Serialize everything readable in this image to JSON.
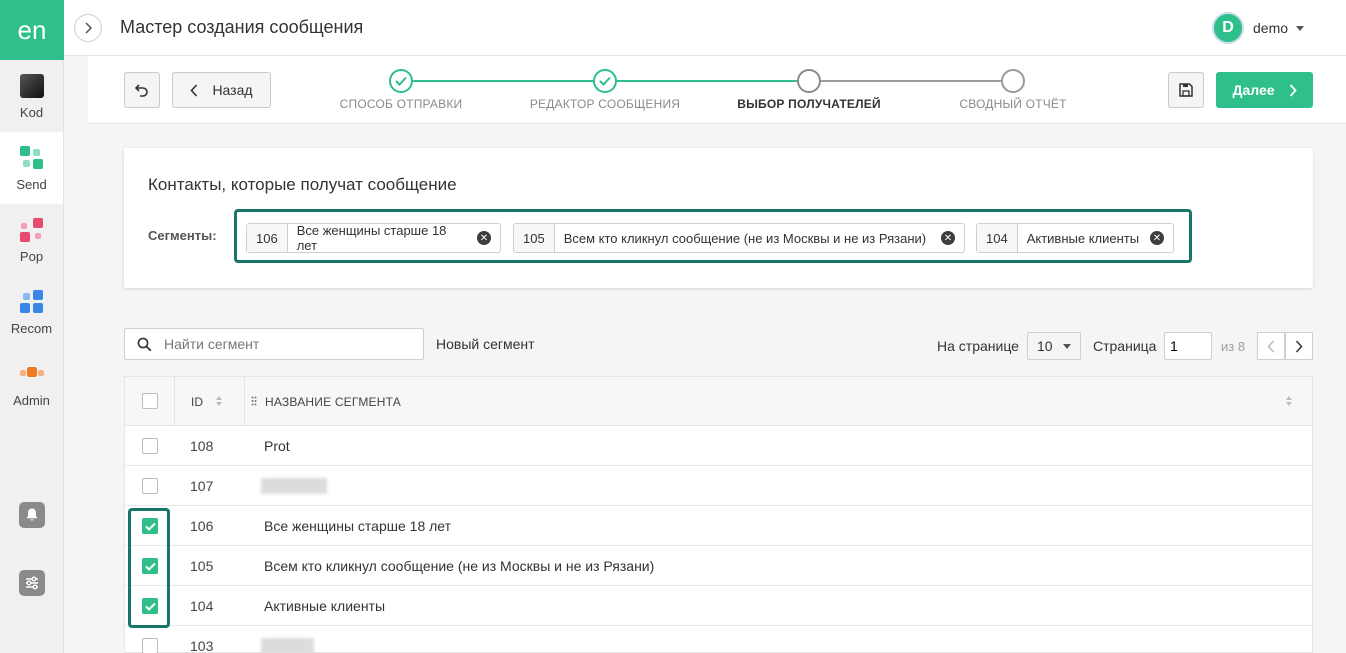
{
  "app": {
    "logo": "en",
    "title": "Мастер создания сообщения"
  },
  "rail": {
    "items": [
      {
        "label": "Kod",
        "icon": "kod-icon"
      },
      {
        "label": "Send",
        "icon": "send-icon",
        "active": true
      },
      {
        "label": "Pop",
        "icon": "pop-icon"
      },
      {
        "label": "Recom",
        "icon": "recom-icon"
      },
      {
        "label": "Admin",
        "icon": "admin-icon"
      }
    ],
    "bottom": [
      {
        "icon": "bell-icon"
      },
      {
        "icon": "sliders-icon"
      }
    ]
  },
  "user": {
    "initial": "D",
    "name": "demo"
  },
  "toolbar": {
    "back_label": "Назад",
    "next_label": "Далее"
  },
  "steps": [
    {
      "label": "СПОСОБ ОТПРАВКИ",
      "state": "done"
    },
    {
      "label": "РЕДАКТОР СООБЩЕНИЯ",
      "state": "done"
    },
    {
      "label": "ВЫБОР ПОЛУЧАТЕЛЕЙ",
      "state": "current"
    },
    {
      "label": "СВОДНЫЙ ОТЧЁТ",
      "state": "pending"
    }
  ],
  "contacts": {
    "title": "Контакты, которые получат сообщение",
    "segments_label": "Сегменты:",
    "tags": [
      {
        "id": "106",
        "name": "Все женщины старше 18 лет"
      },
      {
        "id": "105",
        "name": "Всем кто кликнул сообщение (не из Москвы и не из Рязани)"
      },
      {
        "id": "104",
        "name": "Активные клиенты"
      }
    ]
  },
  "search": {
    "placeholder": "Найти сегмент",
    "value": ""
  },
  "new_segment_label": "Новый сегмент",
  "pagination": {
    "per_page_label": "На странице",
    "per_page": "10",
    "page_label": "Страница",
    "page": "1",
    "of_label": "из 8"
  },
  "table": {
    "columns": {
      "id": "ID",
      "name": "НАЗВАНИЕ СЕГМЕНТА"
    },
    "rows": [
      {
        "id": "108",
        "name": "Prot",
        "checked": false
      },
      {
        "id": "107",
        "name": "",
        "checked": false,
        "redacted": true
      },
      {
        "id": "106",
        "name": "Все женщины старше 18 лет",
        "checked": true
      },
      {
        "id": "105",
        "name": "Всем кто кликнул сообщение (не из Москвы и не из Рязани)",
        "checked": true
      },
      {
        "id": "104",
        "name": "Активные клиенты",
        "checked": true
      },
      {
        "id": "103",
        "name": "",
        "checked": false,
        "redacted": true
      }
    ]
  },
  "colors": {
    "accent": "#2fbf8a",
    "highlight": "#17756a"
  }
}
